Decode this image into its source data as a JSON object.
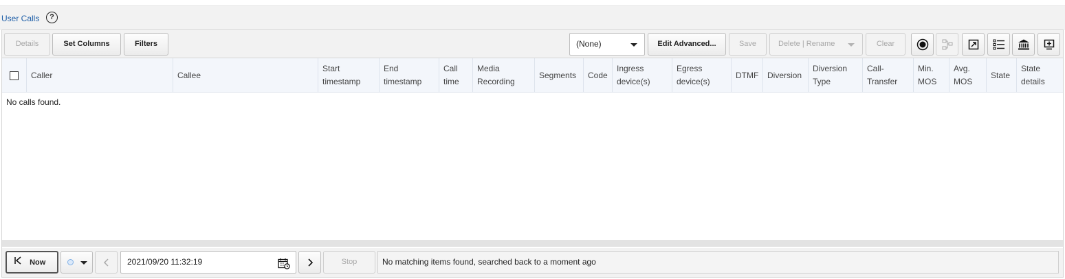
{
  "title": "User Calls",
  "help_icon": "?",
  "toolbar": {
    "details": "Details",
    "set_columns": "Set Columns",
    "filters": "Filters",
    "view_select": "(None)",
    "edit_advanced": "Edit Advanced...",
    "save": "Save",
    "delete_rename": "Delete | Rename",
    "clear": "Clear",
    "icons": [
      "record-icon",
      "diagram-icon",
      "export-icon",
      "list-icon",
      "bank-icon",
      "add-panel-icon"
    ]
  },
  "columns": [
    {
      "l1": "Caller",
      "l2": ""
    },
    {
      "l1": "Callee",
      "l2": ""
    },
    {
      "l1": "Start",
      "l2": "timestamp"
    },
    {
      "l1": "End",
      "l2": "timestamp"
    },
    {
      "l1": "Call",
      "l2": "time"
    },
    {
      "l1": "Media",
      "l2": "Recording"
    },
    {
      "l1": "Segments",
      "l2": ""
    },
    {
      "l1": "Code",
      "l2": ""
    },
    {
      "l1": "Ingress",
      "l2": "device(s)"
    },
    {
      "l1": "Egress",
      "l2": "device(s)"
    },
    {
      "l1": "DTMF",
      "l2": ""
    },
    {
      "l1": "Diversion",
      "l2": ""
    },
    {
      "l1": "Diversion",
      "l2": "Type"
    },
    {
      "l1": "Call-",
      "l2": "Transfer"
    },
    {
      "l1": "Min.",
      "l2": "MOS"
    },
    {
      "l1": "Avg.",
      "l2": "MOS"
    },
    {
      "l1": "State",
      "l2": ""
    },
    {
      "l1": "State",
      "l2": "details"
    }
  ],
  "empty_message": "No calls found.",
  "footer": {
    "now": "Now",
    "datetime": "2021/09/20 11:32:19",
    "stop": "Stop",
    "status": "No matching items found, searched back to a moment ago"
  },
  "colors": {
    "title": "#1f5fa8",
    "header_bg": "#f3f6fb"
  }
}
